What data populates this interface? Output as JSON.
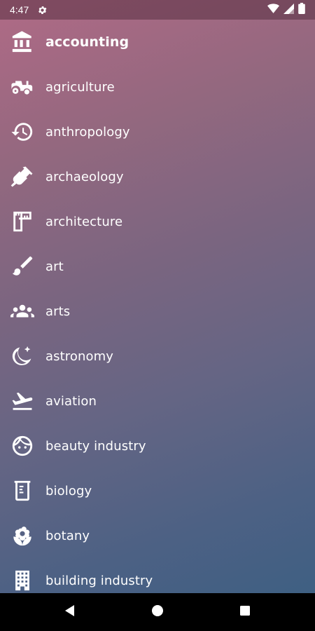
{
  "status_bar": {
    "time": "4:47",
    "icons": [
      "settings-icon",
      "wifi-icon",
      "signal-icon",
      "battery-icon"
    ]
  },
  "categories": [
    {
      "label": "accounting",
      "icon": "bank-icon",
      "selected": true
    },
    {
      "label": "agriculture",
      "icon": "tractor-icon"
    },
    {
      "label": "anthropology",
      "icon": "history-icon"
    },
    {
      "label": "archaeology",
      "icon": "shovel-icon"
    },
    {
      "label": "architecture",
      "icon": "ruler-square-icon"
    },
    {
      "label": "art",
      "icon": "brush-icon"
    },
    {
      "label": "arts",
      "icon": "group-icon"
    },
    {
      "label": "astronomy",
      "icon": "moon-star-icon"
    },
    {
      "label": "aviation",
      "icon": "airplane-takeoff-icon"
    },
    {
      "label": "beauty industry",
      "icon": "face-icon"
    },
    {
      "label": "biology",
      "icon": "beaker-icon"
    },
    {
      "label": "botany",
      "icon": "flower-icon"
    },
    {
      "label": "building industry",
      "icon": "building-icon"
    }
  ],
  "nav_bar": {
    "buttons": [
      "back-icon",
      "home-icon",
      "recents-icon"
    ]
  }
}
